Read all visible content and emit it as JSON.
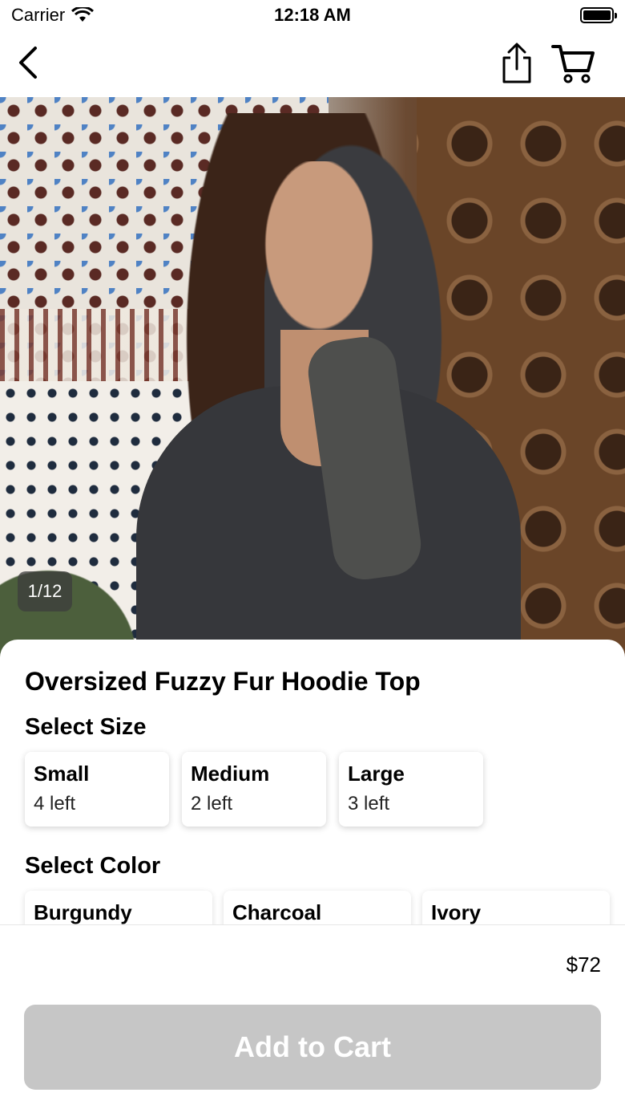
{
  "status_bar": {
    "carrier": "Carrier",
    "time": "12:18 AM"
  },
  "nav": {
    "back_icon": "chevron-left-icon",
    "share_icon": "share-icon",
    "cart_icon": "cart-icon"
  },
  "gallery": {
    "counter": "1/12"
  },
  "product": {
    "title": "Oversized Fuzzy Fur Hoodie Top",
    "size_section_title": "Select Size",
    "sizes": [
      {
        "name": "Small",
        "stock": "4 left"
      },
      {
        "name": "Medium",
        "stock": "2 left"
      },
      {
        "name": "Large",
        "stock": "3 left"
      }
    ],
    "color_section_title": "Select Color",
    "colors": [
      {
        "name": "Burgundy"
      },
      {
        "name": "Charcoal"
      },
      {
        "name": "Ivory"
      }
    ]
  },
  "checkout": {
    "price": "$72",
    "add_to_cart_label": "Add to Cart",
    "button_color": "#c6c6c6"
  }
}
